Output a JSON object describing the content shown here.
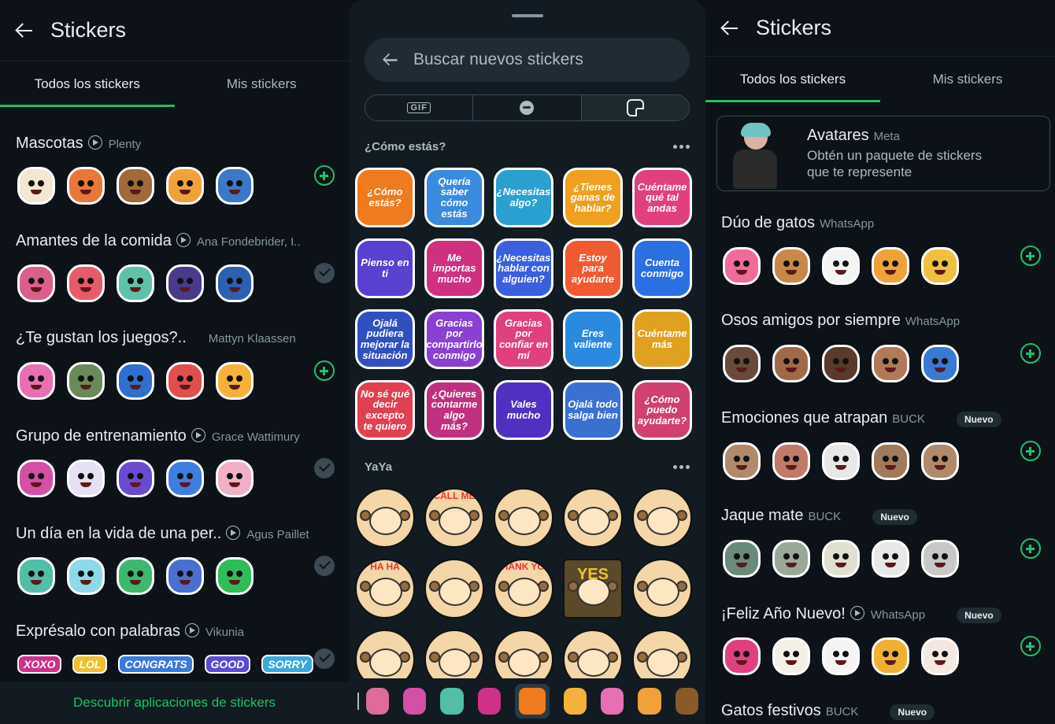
{
  "left": {
    "title": "Stickers",
    "tabs": [
      "Todos los stickers",
      "Mis stickers"
    ],
    "packs": [
      {
        "name": "Mascotas",
        "author": "Plenty",
        "play": true,
        "status": "add",
        "colors": [
          "#f3e6d2",
          "#e9773b",
          "#a06a3a",
          "#f0a23a",
          "#3c78c8"
        ]
      },
      {
        "name": "Amantes de la comida",
        "author": "Ana Fondebrider, I..",
        "play": true,
        "status": "added",
        "colors": [
          "#d9608a",
          "#e65a6b",
          "#5ec2a8",
          "#4a3a8a",
          "#2f5fb0"
        ]
      },
      {
        "name": "¿Te gustan los juegos?..",
        "author": "Mattyn Klaassen",
        "play": false,
        "status": "add",
        "colors": [
          "#e86fb4",
          "#6b8a5a",
          "#2e6fd0",
          "#e04e4e",
          "#f4b23a"
        ]
      },
      {
        "name": "Grupo de entrenamiento",
        "author": "Grace Wattimury",
        "play": true,
        "status": "added",
        "colors": [
          "#d44fa6",
          "#e6e0f4",
          "#6a4bd0",
          "#3e7ee0",
          "#f2b0c8"
        ]
      },
      {
        "name": "Un día en la vida de una per..",
        "author": "Agus Paillet",
        "play": true,
        "status": "added",
        "colors": [
          "#4fbfa8",
          "#8fd8e8",
          "#3db86e",
          "#4a6fd0",
          "#2ebd58"
        ]
      },
      {
        "name": "Exprésalo con palabras",
        "author": "Vikunia",
        "play": true,
        "status": "added",
        "colors": [
          "#d0308a",
          "#f0c030",
          "#3a7ae0",
          "#5a4ad8",
          "#3aa8e0"
        ]
      }
    ],
    "word_stickers": [
      "XOXO",
      "LOL",
      "CONGRATS",
      "GOOD",
      "SORRY"
    ],
    "footer": "Descubrir aplicaciones de stickers"
  },
  "middle": {
    "search_placeholder": "Buscar nuevos stickers",
    "segments": [
      "GIF"
    ],
    "group1": {
      "name": "¿Cómo estás?",
      "stickers": [
        {
          "text": "¿Cómo estás?",
          "color": "#f07a1e"
        },
        {
          "text": "Quería saber cómo estás",
          "color": "#3a8ae0"
        },
        {
          "text": "¿Necesitas algo?",
          "color": "#2aa0d0"
        },
        {
          "text": "¿Tienes ganas de hablar?",
          "color": "#f0a020"
        },
        {
          "text": "Cuéntame qué tal andas",
          "color": "#e04080"
        },
        {
          "text": "Pienso en ti",
          "color": "#5a40d0"
        },
        {
          "text": "Me importas mucho",
          "color": "#d03080"
        },
        {
          "text": "¿Necesitas hablar con alguien?",
          "color": "#3a60e0"
        },
        {
          "text": "Estoy para ayudarte",
          "color": "#f05a30"
        },
        {
          "text": "Cuenta conmigo",
          "color": "#2a70e0"
        },
        {
          "text": "Ojalá pudiera mejorar la situación",
          "color": "#3050c0"
        },
        {
          "text": "Gracias por compartirlo conmigo",
          "color": "#8a40d0"
        },
        {
          "text": "Gracias por confiar en mí",
          "color": "#e04080"
        },
        {
          "text": "Eres valiente",
          "color": "#2a8ae0"
        },
        {
          "text": "Cuéntame más",
          "color": "#e0a020"
        },
        {
          "text": "No sé qué decir excepto te quiero",
          "color": "#e04050"
        },
        {
          "text": "¿Quieres contarme algo más?",
          "color": "#c03080"
        },
        {
          "text": "Vales mucho",
          "color": "#5030c0"
        },
        {
          "text": "Ojalá todo salga bien",
          "color": "#3a70d0"
        },
        {
          "text": "¿Cómo puedo ayudarte?",
          "color": "#d04070"
        }
      ]
    },
    "group2": {
      "name": "YaYa",
      "stickers": [
        "",
        "CALL ME",
        "",
        "",
        "",
        "HA HA",
        "",
        "THANK YOU",
        "YES",
        "",
        "",
        "",
        "",
        "",
        ""
      ]
    },
    "tray_colors": [
      "#e06a9a",
      "#d44fa6",
      "#4fbfa8",
      "#d0308a",
      "#f07a1e",
      "#f4b23a",
      "#e86fb4",
      "#f0a23a",
      "#8a5a2b"
    ]
  },
  "right": {
    "title": "Stickers",
    "tabs": [
      "Todos los stickers",
      "Mis stickers"
    ],
    "avatar_card": {
      "title": "Avatares",
      "meta": "Meta",
      "desc": "Obtén un paquete de stickers que te represente"
    },
    "packs": [
      {
        "name": "Dúo de gatos",
        "author": "WhatsApp",
        "play": false,
        "badge": "",
        "colors": [
          "#f06a9a",
          "#c8884a",
          "#f4f4f4",
          "#f0a23a",
          "#f0c040"
        ]
      },
      {
        "name": "Osos amigos por siempre",
        "author": "WhatsApp",
        "play": false,
        "badge": "",
        "colors": [
          "#6a4a3a",
          "#a06a4a",
          "#5a3a2a",
          "#b07a5a",
          "#3a7ad0"
        ]
      },
      {
        "name": "Emociones que atrapan",
        "author": "BUCK",
        "play": false,
        "badge": "Nuevo",
        "colors": [
          "#b08a6a",
          "#c07a6a",
          "#e8e8e8",
          "#a07a5a",
          "#b08a6a"
        ]
      },
      {
        "name": "Jaque mate",
        "author": "BUCK",
        "play": false,
        "badge": "Nuevo",
        "colors": [
          "#6a8a7a",
          "#9aa89a",
          "#e0e0d0",
          "#e8e8e8",
          "#c8c8c8"
        ]
      },
      {
        "name": "¡Feliz Año Nuevo!",
        "author": "WhatsApp",
        "play": true,
        "badge": "Nuevo",
        "colors": [
          "#e04080",
          "#f4f0e8",
          "#f4f4f4",
          "#f0b030",
          "#f4e8e0"
        ]
      },
      {
        "name": "Gatos festivos",
        "author": "BUCK",
        "play": false,
        "badge": "Nuevo",
        "colors": []
      }
    ]
  }
}
